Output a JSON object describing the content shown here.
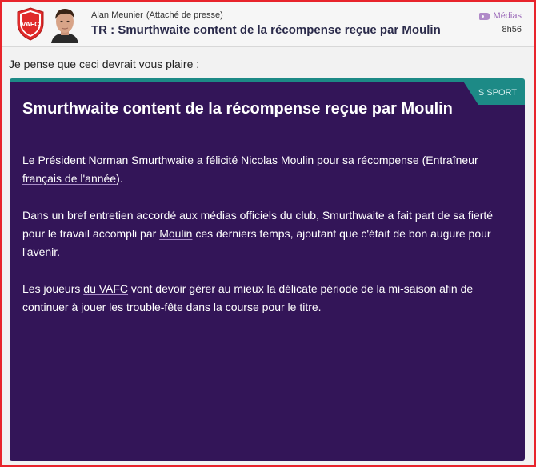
{
  "header": {
    "club_badge_text": "VAFC",
    "sender_name": "Alan Meunier",
    "sender_role": "(Attaché de presse)",
    "subject": "TR : Smurthwaite content de la récompense reçue par Moulin",
    "category": "Médias",
    "time": "8h56"
  },
  "intro": "Je pense que ceci devrait vous plaire :",
  "card": {
    "tag": "S SPORT",
    "title": "Smurthwaite content de la récompense reçue par Moulin",
    "p1": {
      "a": "Le Président Norman Smurthwaite a félicité ",
      "link1": "Nicolas Moulin",
      "b": " pour sa récompense (",
      "link2": "Entraîneur français de l'année",
      "c": ")."
    },
    "p2": {
      "a": "Dans un bref entretien accordé aux médias officiels du club, Smurthwaite a fait part de sa fierté pour le travail accompli par ",
      "link1": "Moulin",
      "b": " ces derniers temps, ajoutant que c'était de bon augure pour l'avenir."
    },
    "p3": {
      "a": "Les joueurs ",
      "link1": "du VAFC",
      "b": " vont devoir gérer au mieux la délicate période de la mi-saison afin de continuer à jouer les trouble-fête dans la course pour le titre."
    }
  },
  "colors": {
    "frame": "#e8242c",
    "card_bg": "#331558",
    "card_accent": "#1d8a86",
    "category": "#9a68b8"
  },
  "icons": {
    "club_badge": "club-badge-icon",
    "avatar": "sender-avatar",
    "category": "tag-icon"
  }
}
